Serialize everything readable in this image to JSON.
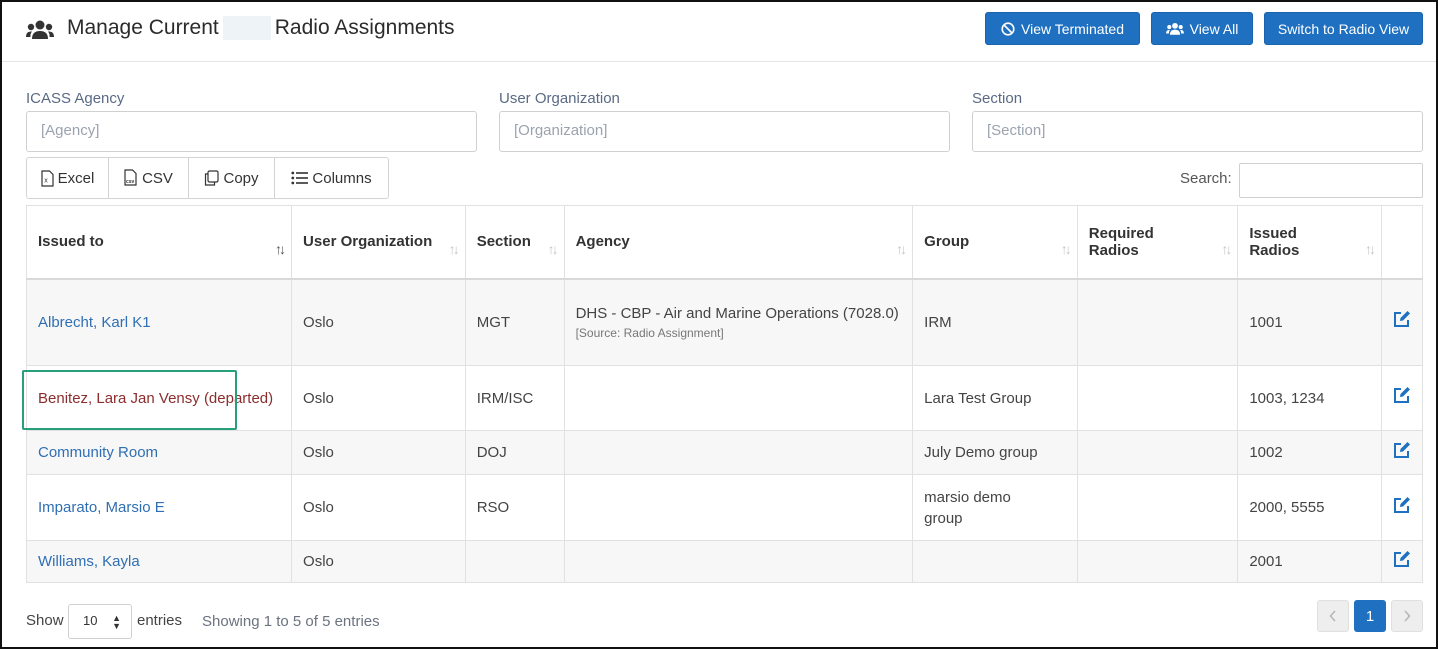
{
  "header": {
    "title_pre": "Manage Current",
    "title_post": "Radio Assignments",
    "btn_terminated": "View Terminated",
    "btn_view_all": "View All",
    "btn_switch": "Switch to Radio View"
  },
  "filters": {
    "agency": {
      "label": "ICASS Agency",
      "placeholder": "[Agency]"
    },
    "org": {
      "label": "User Organization",
      "placeholder": "[Organization]"
    },
    "section": {
      "label": "Section",
      "placeholder": "[Section]"
    }
  },
  "export": {
    "excel": "Excel",
    "csv": "CSV",
    "copy": "Copy",
    "columns": "Columns"
  },
  "search": {
    "label": "Search:"
  },
  "columns": {
    "issued_to": "Issued to",
    "user_org": "User Organization",
    "section": "Section",
    "agency": "Agency",
    "group": "Group",
    "required_1": "Required",
    "required_2": "Radios",
    "issued_1": "Issued",
    "issued_2": "Radios"
  },
  "rows": [
    {
      "name": "Albrecht, Karl K1",
      "org": "Oslo",
      "section": "MGT",
      "agency": "DHS - CBP - Air and Marine Operations (7028.0)",
      "agency_source": "[Source: Radio Assignment]",
      "group": "IRM",
      "required": "",
      "issued": "1001"
    },
    {
      "name": "Benitez, Lara Jan Vensy (departed)",
      "org": "Oslo",
      "section": "IRM/ISC",
      "agency": "",
      "agency_source": "",
      "group": "Lara Test Group",
      "required": "",
      "issued": "1003, 1234"
    },
    {
      "name": "Community Room",
      "org": "Oslo",
      "section": "DOJ",
      "agency": "",
      "agency_source": "",
      "group": "July Demo group",
      "required": "",
      "issued": "1002"
    },
    {
      "name": "Imparato, Marsio E",
      "org": "Oslo",
      "section": "RSO",
      "agency": "",
      "agency_source": "",
      "group": "marsio demo group",
      "required": "",
      "issued": "2000, 5555"
    },
    {
      "name": "Williams, Kayla",
      "org": "Oslo",
      "section": "",
      "agency": "",
      "agency_source": "",
      "group": "",
      "required": "",
      "issued": "2001"
    }
  ],
  "footer": {
    "show": "Show",
    "page_length": "10",
    "entries": "entries",
    "info": "Showing 1 to 5 of 5 entries",
    "current_page": "1"
  },
  "colors": {
    "accent": "#1f70c1",
    "link": "#2f6fb3",
    "departed": "#8c2d2d",
    "highlight": "#25a07a"
  }
}
